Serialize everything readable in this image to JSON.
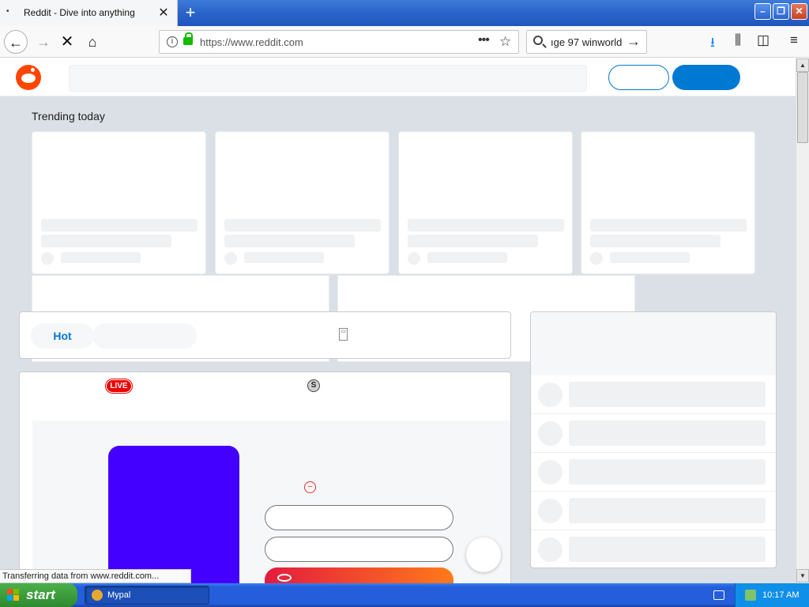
{
  "browser": {
    "tab": {
      "title": "Reddit - Dive into anything",
      "close_glyph": "✕"
    },
    "new_tab_glyph": "+",
    "window_buttons": {
      "minimize": "–",
      "maximize": "❐",
      "close": "✕"
    },
    "nav": {
      "back": "←",
      "forward": "→",
      "stop": "✕",
      "home": "⌂"
    },
    "url": "https://www.reddit.com",
    "url_icons": {
      "info": "i",
      "more": "•••",
      "star": "☆"
    },
    "search_value": "ıge 97 winworld",
    "search_go": "→",
    "toolbar_icons": {
      "download": "⭳",
      "library": "⫼",
      "sidebar": "◫",
      "menu": "≡"
    },
    "status_text": "Transferring data from www.reddit.com..."
  },
  "page": {
    "trending_label": "Trending today",
    "trending_cards": [
      {
        "id": "card-1"
      },
      {
        "id": "card-2"
      },
      {
        "id": "card-3"
      },
      {
        "id": "card-4"
      }
    ],
    "sort_bar": {
      "active_label": "Hot",
      "layout_icon": "▭"
    },
    "post": {
      "live_badge": "LIVE",
      "s_icon": "S",
      "minus_icon": "−"
    },
    "sidebar_rows": 5
  },
  "colors": {
    "reddit_orange": "#ff4500",
    "reddit_blue": "#0079d3",
    "page_bg": "#dae0e6",
    "purple_panel": "#4400ff",
    "gradient_start": "#e41b3e",
    "gradient_end": "#ff7a1a"
  },
  "taskbar": {
    "start_label": "start",
    "items": [
      {
        "label": "Mypal"
      }
    ],
    "clock": "10:17 AM"
  }
}
